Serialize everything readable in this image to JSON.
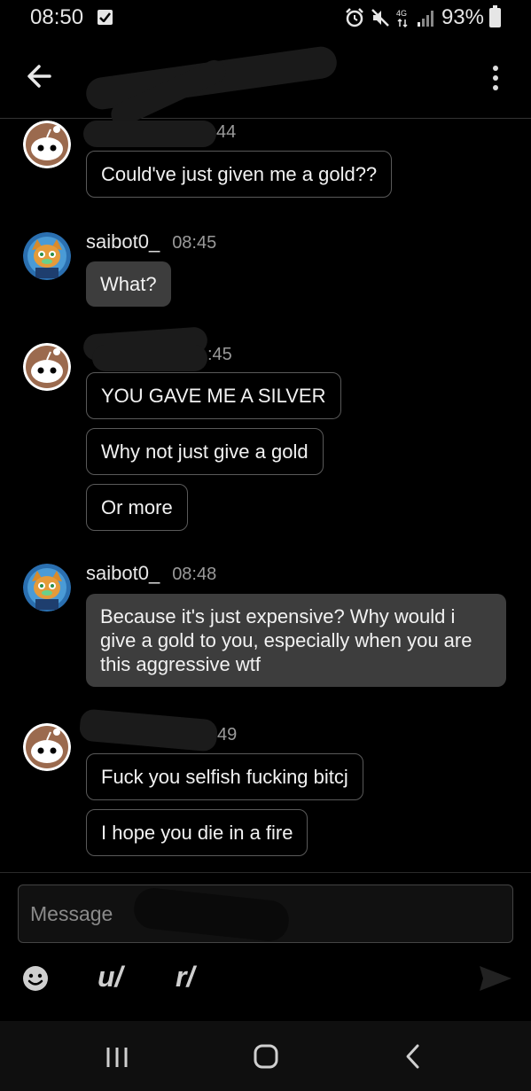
{
  "status_bar": {
    "time": "08:50",
    "battery": "93%"
  },
  "header": {
    "title": ""
  },
  "messages": [
    {
      "sender": "",
      "time_partial": "44",
      "side": "other",
      "bubbles": [
        "Could've just given me a gold??"
      ]
    },
    {
      "sender": "saibot0_",
      "time": "08:45",
      "side": "self",
      "bubbles": [
        "What?"
      ]
    },
    {
      "sender": "",
      "time_partial": ":45",
      "side": "other",
      "bubbles": [
        "YOU GAVE ME A SILVER",
        "Why not just give a gold",
        "Or more"
      ]
    },
    {
      "sender": "saibot0_",
      "time": "08:48",
      "side": "self",
      "bubbles": [
        "Because it's just expensive? Why would i give a gold to you, especially when you are this aggressive wtf"
      ]
    },
    {
      "sender": "",
      "time_partial": "49",
      "side": "other",
      "bubbles": [
        "Fuck you selfish fucking bitcj",
        "I hope you die in a fire"
      ]
    }
  ],
  "composer": {
    "placeholder": "Message",
    "user_shortcut": "u/",
    "subreddit_shortcut": "r/"
  },
  "colors": {
    "background": "#000000",
    "bubble_self": "#3d3d3d",
    "bubble_other_border": "#5a5a5a"
  },
  "icons": [
    "back-arrow-icon",
    "overflow-menu-icon",
    "emoji-icon",
    "send-icon",
    "recent-apps-icon",
    "home-icon",
    "nav-back-icon",
    "alarm-icon",
    "mute-icon",
    "signal-icon",
    "battery-icon",
    "notification-check-icon"
  ]
}
